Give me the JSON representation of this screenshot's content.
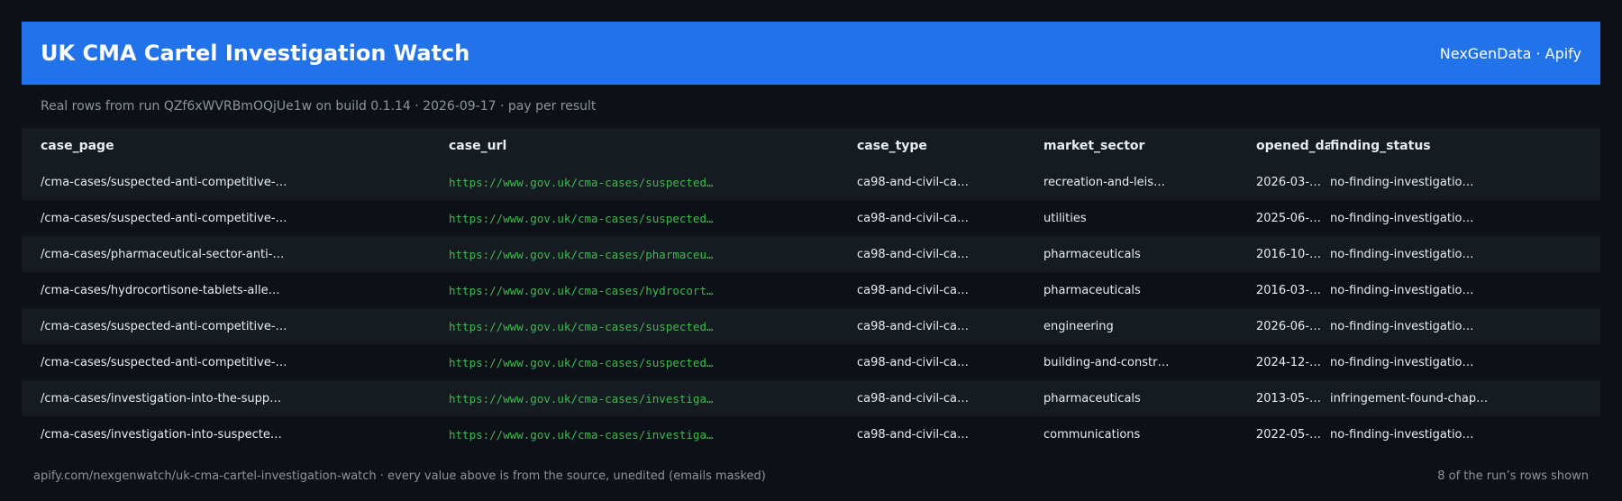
{
  "header": {
    "title": "UK CMA Cartel Investigation Watch",
    "brand": "NexGenData · Apify"
  },
  "subtitle": "Real rows from run QZf6xWVRBmOQjUe1w on build 0.1.14 · 2026-09-17 · pay per result",
  "table": {
    "columns": [
      "case_page",
      "case_url",
      "case_type",
      "market_sector",
      "opened_date",
      "finding_status"
    ],
    "rows": [
      [
        "/cma-cases/suspected-anti-competitive-…",
        "https://www.gov.uk/cma-cases/suspected…",
        "ca98-and-civil-ca…",
        "recreation-and-leis…",
        "2026-03-…",
        "no-finding-investigatio…"
      ],
      [
        "/cma-cases/suspected-anti-competitive-…",
        "https://www.gov.uk/cma-cases/suspected…",
        "ca98-and-civil-ca…",
        "utilities",
        "2025-06-…",
        "no-finding-investigatio…"
      ],
      [
        "/cma-cases/pharmaceutical-sector-anti-…",
        "https://www.gov.uk/cma-cases/pharmaceu…",
        "ca98-and-civil-ca…",
        "pharmaceuticals",
        "2016-10-…",
        "no-finding-investigatio…"
      ],
      [
        "/cma-cases/hydrocortisone-tablets-alle…",
        "https://www.gov.uk/cma-cases/hydrocort…",
        "ca98-and-civil-ca…",
        "pharmaceuticals",
        "2016-03-…",
        "no-finding-investigatio…"
      ],
      [
        "/cma-cases/suspected-anti-competitive-…",
        "https://www.gov.uk/cma-cases/suspected…",
        "ca98-and-civil-ca…",
        "engineering",
        "2026-06-…",
        "no-finding-investigatio…"
      ],
      [
        "/cma-cases/suspected-anti-competitive-…",
        "https://www.gov.uk/cma-cases/suspected…",
        "ca98-and-civil-ca…",
        "building-and-constr…",
        "2024-12-…",
        "no-finding-investigatio…"
      ],
      [
        "/cma-cases/investigation-into-the-supp…",
        "https://www.gov.uk/cma-cases/investiga…",
        "ca98-and-civil-ca…",
        "pharmaceuticals",
        "2013-05-…",
        "infringement-found-chap…"
      ],
      [
        "/cma-cases/investigation-into-suspecte…",
        "https://www.gov.uk/cma-cases/investiga…",
        "ca98-and-civil-ca…",
        "communications",
        "2022-05-…",
        "no-finding-investigatio…"
      ]
    ]
  },
  "footer": {
    "left": "apify.com/nexgenwatch/uk-cma-cartel-investigation-watch  ·  every value above is from the source, unedited (emails masked)",
    "right": "8 of the run’s rows shown"
  },
  "colors": {
    "background": "#0d1117",
    "header": "#2272ea",
    "url": "#3fb950",
    "muted": "#8b949e"
  }
}
